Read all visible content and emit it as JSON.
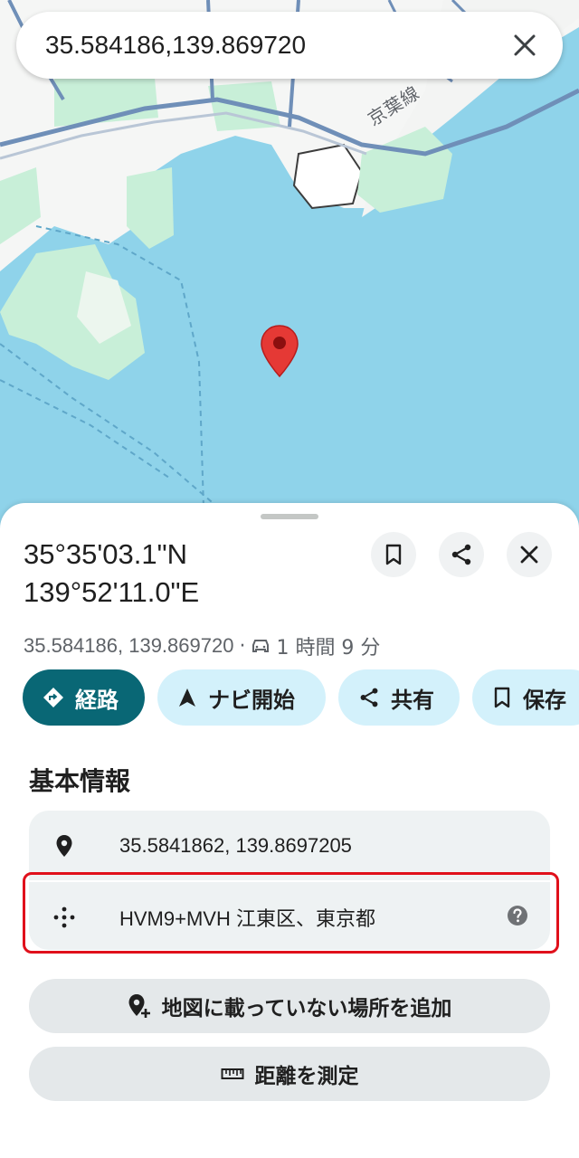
{
  "search": {
    "query": "35.584186,139.869720"
  },
  "map": {
    "rail_label": "京葉線"
  },
  "place": {
    "title_line1": "35°35'03.1\"N",
    "title_line2": "139°52'11.0\"E",
    "coords_short": "35.584186, 139.869720",
    "separator": "·",
    "drive_time": "1 時間 9 分"
  },
  "actions": {
    "directions": "経路",
    "navigate": "ナビ開始",
    "share": "共有",
    "save": "保存"
  },
  "info": {
    "section_title": "基本情報",
    "coordinates": "35.5841862, 139.8697205",
    "plus_code": "HVM9+MVH 江東区、東京都"
  },
  "buttons": {
    "add_place": "地図に載っていない場所を追加",
    "measure": "距離を測定"
  },
  "colors": {
    "water": "#8fd3ea",
    "park": "#c8efd8",
    "land": "#f5f6f5",
    "primary_chip": "#096775",
    "chip": "#d3f1fb",
    "pin": "#e53935",
    "highlight": "#e0101b"
  }
}
